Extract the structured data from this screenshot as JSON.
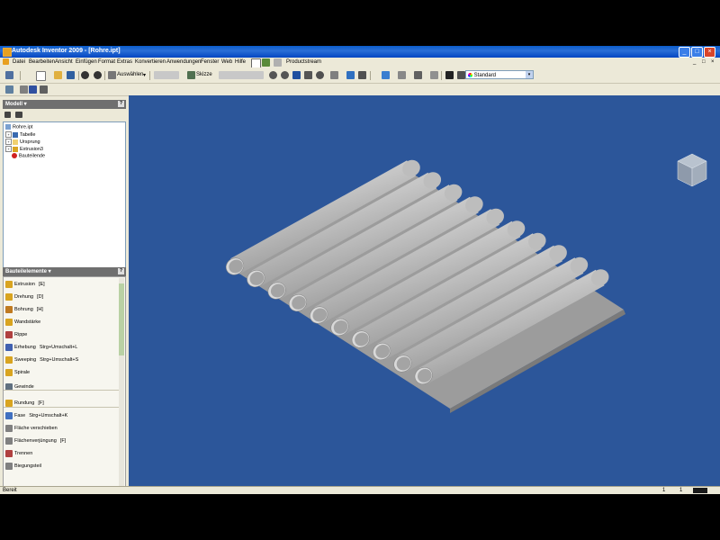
{
  "titlebar": {
    "title": "Autodesk Inventor 2009 - [Rohre.ipt]",
    "minimize": "_",
    "maximize": "□",
    "close": "×"
  },
  "menu": [
    "Datei",
    "Bearbeiten",
    "Ansicht",
    "Einfügen",
    "Format",
    "Extras",
    "Konvertieren",
    "Anwendungen",
    "Fenster",
    "Web",
    "Hilfe"
  ],
  "menu_extra": {
    "productstream": "Productstream",
    "doc_minimize": "_",
    "doc_restore": "□",
    "doc_close": "×"
  },
  "toolbar": {
    "select_label": "Auswählen",
    "select_arrow": "▾",
    "sketch_label": "Skizze",
    "style_value": "Standard",
    "style_arrow": "▾"
  },
  "browser": {
    "header": "Modell ▾",
    "help": "?",
    "items": [
      {
        "label": "Rohre.ipt",
        "icon": "part-icon"
      },
      {
        "label": "Tabelle",
        "icon": "table-icon"
      },
      {
        "label": "Ursprung",
        "icon": "folder-icon"
      },
      {
        "label": "Extrusion3",
        "icon": "extrusion-icon"
      },
      {
        "label": "Bauteilende",
        "icon": "end-of-part-icon"
      }
    ]
  },
  "features": {
    "header": "Bauteilelemente ▾",
    "help": "?",
    "items": [
      {
        "label": "Extrusion",
        "shortcut": "[E]",
        "icon": "extrude-icon",
        "color": "#d9a420"
      },
      {
        "label": "Drehung",
        "shortcut": "[D]",
        "icon": "revolve-icon",
        "color": "#d9a420"
      },
      {
        "label": "Bohrung",
        "shortcut": "[H]",
        "icon": "hole-icon",
        "color": "#c07a20"
      },
      {
        "label": "Wandstärke",
        "shortcut": "",
        "icon": "shell-icon",
        "color": "#d9a420"
      },
      {
        "label": "Rippe",
        "shortcut": "",
        "icon": "rib-icon",
        "color": "#b04040"
      },
      {
        "label": "Erhebung",
        "shortcut": "Strg+Umschalt+L",
        "icon": "loft-icon",
        "color": "#4060b0"
      },
      {
        "label": "Sweeping",
        "shortcut": "Strg+Umschalt+S",
        "icon": "sweep-icon",
        "color": "#d9a420"
      },
      {
        "label": "Spirale",
        "shortcut": "",
        "icon": "coil-icon",
        "color": "#d9a420"
      },
      {
        "label": "Gewinde",
        "shortcut": "",
        "icon": "thread-icon",
        "color": "#607080"
      },
      {
        "label": "Rundung",
        "shortcut": "[F]",
        "icon": "fillet-icon",
        "color": "#d9a420"
      },
      {
        "label": "Fase",
        "shortcut": "Strg+Umschalt+K",
        "icon": "chamfer-icon",
        "color": "#4070c0"
      },
      {
        "label": "Fläche verschieben",
        "shortcut": "",
        "icon": "move-face-icon",
        "color": "#808080"
      },
      {
        "label": "Flächenverjüngung",
        "shortcut": "[F]",
        "icon": "face-draft-icon",
        "color": "#808080"
      },
      {
        "label": "Trennen",
        "shortcut": "",
        "icon": "split-icon",
        "color": "#b04040"
      },
      {
        "label": "Biegungsteil",
        "shortcut": "",
        "icon": "bend-part-icon",
        "color": "#808080"
      }
    ]
  },
  "statusbar": {
    "text": "Bereit",
    "count1": "1",
    "count2": "1"
  },
  "colors": {
    "viewport": "#2c569a",
    "tube": "#c2c2c2"
  }
}
